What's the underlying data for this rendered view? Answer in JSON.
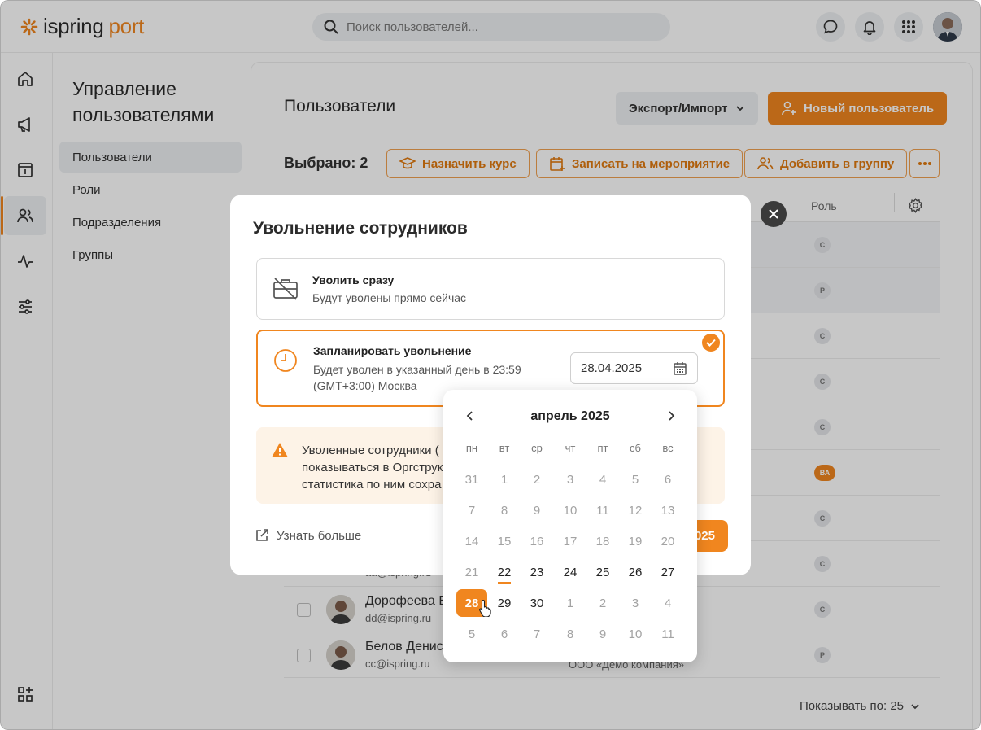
{
  "app": {
    "logo_word1": "ispring",
    "logo_word2": "port",
    "search_placeholder": "Поиск пользователей...",
    "accent": "#f0861f"
  },
  "icons": {
    "chat": "chat-icon",
    "bell": "bell-icon",
    "apps": "apps-grid-icon",
    "rail": [
      "home-icon",
      "megaphone-icon",
      "info-box-icon",
      "users-icon",
      "activity-icon",
      "sliders-icon",
      "add-widget-icon"
    ]
  },
  "subnav": {
    "title": "Управление пользователями",
    "items": [
      "Пользователи",
      "Роли",
      "Подразделения",
      "Группы"
    ],
    "active_index": 0
  },
  "main": {
    "title": "Пользователи",
    "export_label": "Экспорт/Импорт",
    "new_user_label": "Новый пользователь",
    "selected_label": "Выбрано: 2",
    "assign_course_label": "Назначить курс",
    "enroll_event_label": "Записать на мероприятие",
    "add_group_label": "Добавить в группу",
    "role_column": "Роль",
    "page_size_label": "Показывать по: 25",
    "rows": [
      {
        "role": "С",
        "highlight": true
      },
      {
        "role": "Р",
        "highlight": true
      },
      {
        "role": "С",
        "dept_partial": "фис"
      },
      {
        "role": "С"
      },
      {
        "role": "С"
      },
      {
        "role": "ВА",
        "orange": true
      },
      {
        "role": "С"
      },
      {
        "role": "С",
        "email_partial": "aa@ispring.ru",
        "dept_partial": "Главный офис"
      },
      {
        "role": "С",
        "name": "Дорофеева Ви",
        "email": "dd@ispring.ru"
      },
      {
        "role": "Р",
        "name": "Белов Денис",
        "email": "cc@ispring.ru",
        "dept": "ООО «Демо компания»"
      }
    ]
  },
  "modal": {
    "title": "Увольнение сотрудников",
    "option_now_title": "Уволить сразу",
    "option_now_desc": "Будут уволены прямо сейчас",
    "option_plan_title": "Запланировать увольнение",
    "option_plan_desc_1": "Будет уволен в указанный день в 23:59",
    "option_plan_desc_2": "(GMT+3:00) Москва",
    "date_value": "28.04.2025",
    "warning_line1": "Уволенные сотрудники (",
    "warning_line2": "показываться в Оргструк",
    "warning_line3": "статистика по ним сохра",
    "learn_more": "Узнать больше",
    "submit_partial": "025"
  },
  "calendar": {
    "month_label": "апрель 2025",
    "weekdays": [
      "пн",
      "вт",
      "ср",
      "чт",
      "пт",
      "сб",
      "вс"
    ],
    "weeks": [
      [
        {
          "d": "31",
          "s": "muted"
        },
        {
          "d": "1",
          "s": "muted"
        },
        {
          "d": "2",
          "s": "muted"
        },
        {
          "d": "3",
          "s": "muted"
        },
        {
          "d": "4",
          "s": "muted"
        },
        {
          "d": "5",
          "s": "muted"
        },
        {
          "d": "6",
          "s": "muted"
        }
      ],
      [
        {
          "d": "7",
          "s": "muted"
        },
        {
          "d": "8",
          "s": "muted"
        },
        {
          "d": "9",
          "s": "muted"
        },
        {
          "d": "10",
          "s": "muted"
        },
        {
          "d": "11",
          "s": "muted"
        },
        {
          "d": "12",
          "s": "muted"
        },
        {
          "d": "13",
          "s": "muted"
        }
      ],
      [
        {
          "d": "14",
          "s": "muted"
        },
        {
          "d": "15",
          "s": "muted"
        },
        {
          "d": "16",
          "s": "muted"
        },
        {
          "d": "17",
          "s": "muted"
        },
        {
          "d": "18",
          "s": "muted"
        },
        {
          "d": "19",
          "s": "muted"
        },
        {
          "d": "20",
          "s": "muted"
        }
      ],
      [
        {
          "d": "21",
          "s": "muted"
        },
        {
          "d": "22",
          "s": "today"
        },
        {
          "d": "23",
          "s": "active"
        },
        {
          "d": "24",
          "s": "active"
        },
        {
          "d": "25",
          "s": "active"
        },
        {
          "d": "26",
          "s": "active"
        },
        {
          "d": "27",
          "s": "active"
        }
      ],
      [
        {
          "d": "28",
          "s": "selected"
        },
        {
          "d": "29",
          "s": "active"
        },
        {
          "d": "30",
          "s": "active"
        },
        {
          "d": "1",
          "s": "muted"
        },
        {
          "d": "2",
          "s": "muted"
        },
        {
          "d": "3",
          "s": "muted"
        },
        {
          "d": "4",
          "s": "muted"
        }
      ],
      [
        {
          "d": "5",
          "s": "muted"
        },
        {
          "d": "6",
          "s": "muted"
        },
        {
          "d": "7",
          "s": "muted"
        },
        {
          "d": "8",
          "s": "muted"
        },
        {
          "d": "9",
          "s": "muted"
        },
        {
          "d": "10",
          "s": "muted"
        },
        {
          "d": "11",
          "s": "muted"
        }
      ]
    ]
  }
}
